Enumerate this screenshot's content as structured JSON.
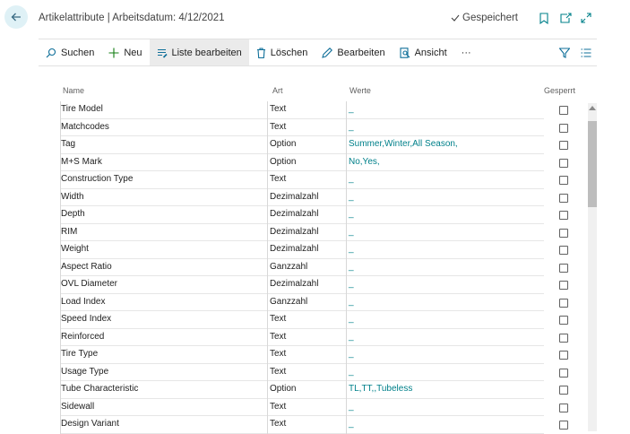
{
  "header": {
    "title": "Artikelattribute | Arbeitsdatum: 4/12/2021",
    "saved_label": "Gespeichert"
  },
  "actions": {
    "search": "Suchen",
    "new": "Neu",
    "edit_list": "Liste bearbeiten",
    "delete": "Löschen",
    "edit": "Bearbeiten",
    "view": "Ansicht",
    "more": "···"
  },
  "columns": {
    "name": "Name",
    "type": "Art",
    "values": "Werte",
    "blocked": "Gesperrt"
  },
  "rows": [
    {
      "name": "Tire Model",
      "type": "Text",
      "values": "_"
    },
    {
      "name": "Matchcodes",
      "type": "Text",
      "values": "_"
    },
    {
      "name": "Tag",
      "type": "Option",
      "values": "Summer,Winter,All Season,"
    },
    {
      "name": "M+S Mark",
      "type": "Option",
      "values": "No,Yes,"
    },
    {
      "name": "Construction Type",
      "type": "Text",
      "values": "_"
    },
    {
      "name": "Width",
      "type": "Dezimalzahl",
      "values": "_"
    },
    {
      "name": "Depth",
      "type": "Dezimalzahl",
      "values": "_"
    },
    {
      "name": "RIM",
      "type": "Dezimalzahl",
      "values": "_"
    },
    {
      "name": "Weight",
      "type": "Dezimalzahl",
      "values": "_"
    },
    {
      "name": "Aspect Ratio",
      "type": "Ganzzahl",
      "values": "_"
    },
    {
      "name": "OVL Diameter",
      "type": "Dezimalzahl",
      "values": "_"
    },
    {
      "name": "Load Index",
      "type": "Ganzzahl",
      "values": "_"
    },
    {
      "name": "Speed Index",
      "type": "Text",
      "values": "_"
    },
    {
      "name": "Reinforced",
      "type": "Text",
      "values": "_"
    },
    {
      "name": "Tire Type",
      "type": "Text",
      "values": "_"
    },
    {
      "name": "Usage Type",
      "type": "Text",
      "values": "_"
    },
    {
      "name": "Tube Characteristic",
      "type": "Option",
      "values": "TL,TT,,Tubeless"
    },
    {
      "name": "Sidewall",
      "type": "Text",
      "values": "_"
    },
    {
      "name": "Design Variant",
      "type": "Text",
      "values": "_"
    }
  ],
  "colors": {
    "accent": "#00808a",
    "back_bg": "#dff1f6"
  },
  "icons": [
    "back-arrow-icon",
    "check-icon",
    "bookmark-icon",
    "open-new-icon",
    "expand-icon",
    "search-icon",
    "plus-icon",
    "edit-list-icon",
    "trash-icon",
    "pencil-icon",
    "view-icon",
    "filter-icon",
    "list-icon"
  ]
}
